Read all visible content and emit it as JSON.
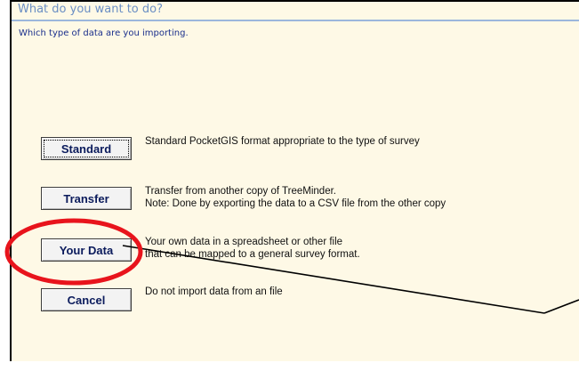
{
  "dialog": {
    "heading": "What do you want to do?",
    "prompt": "Which type of data are you importing."
  },
  "options": [
    {
      "button_label": "Standard",
      "description": [
        "Standard PocketGIS format appropriate to the type of survey"
      ]
    },
    {
      "button_label": "Transfer",
      "description": [
        "Transfer from another copy of TreeMinder.",
        "Note:  Done by exporting the data to a CSV file from the other copy"
      ]
    },
    {
      "button_label": "Your Data",
      "description": [
        "Your own data in a spreadsheet or other file",
        "that can be mapped to a general survey format."
      ]
    },
    {
      "button_label": "Cancel",
      "description": [
        "Do not import data from an file"
      ]
    }
  ],
  "annotation": {
    "highlight_color": "#e8141c",
    "pointer_color": "#000000"
  }
}
